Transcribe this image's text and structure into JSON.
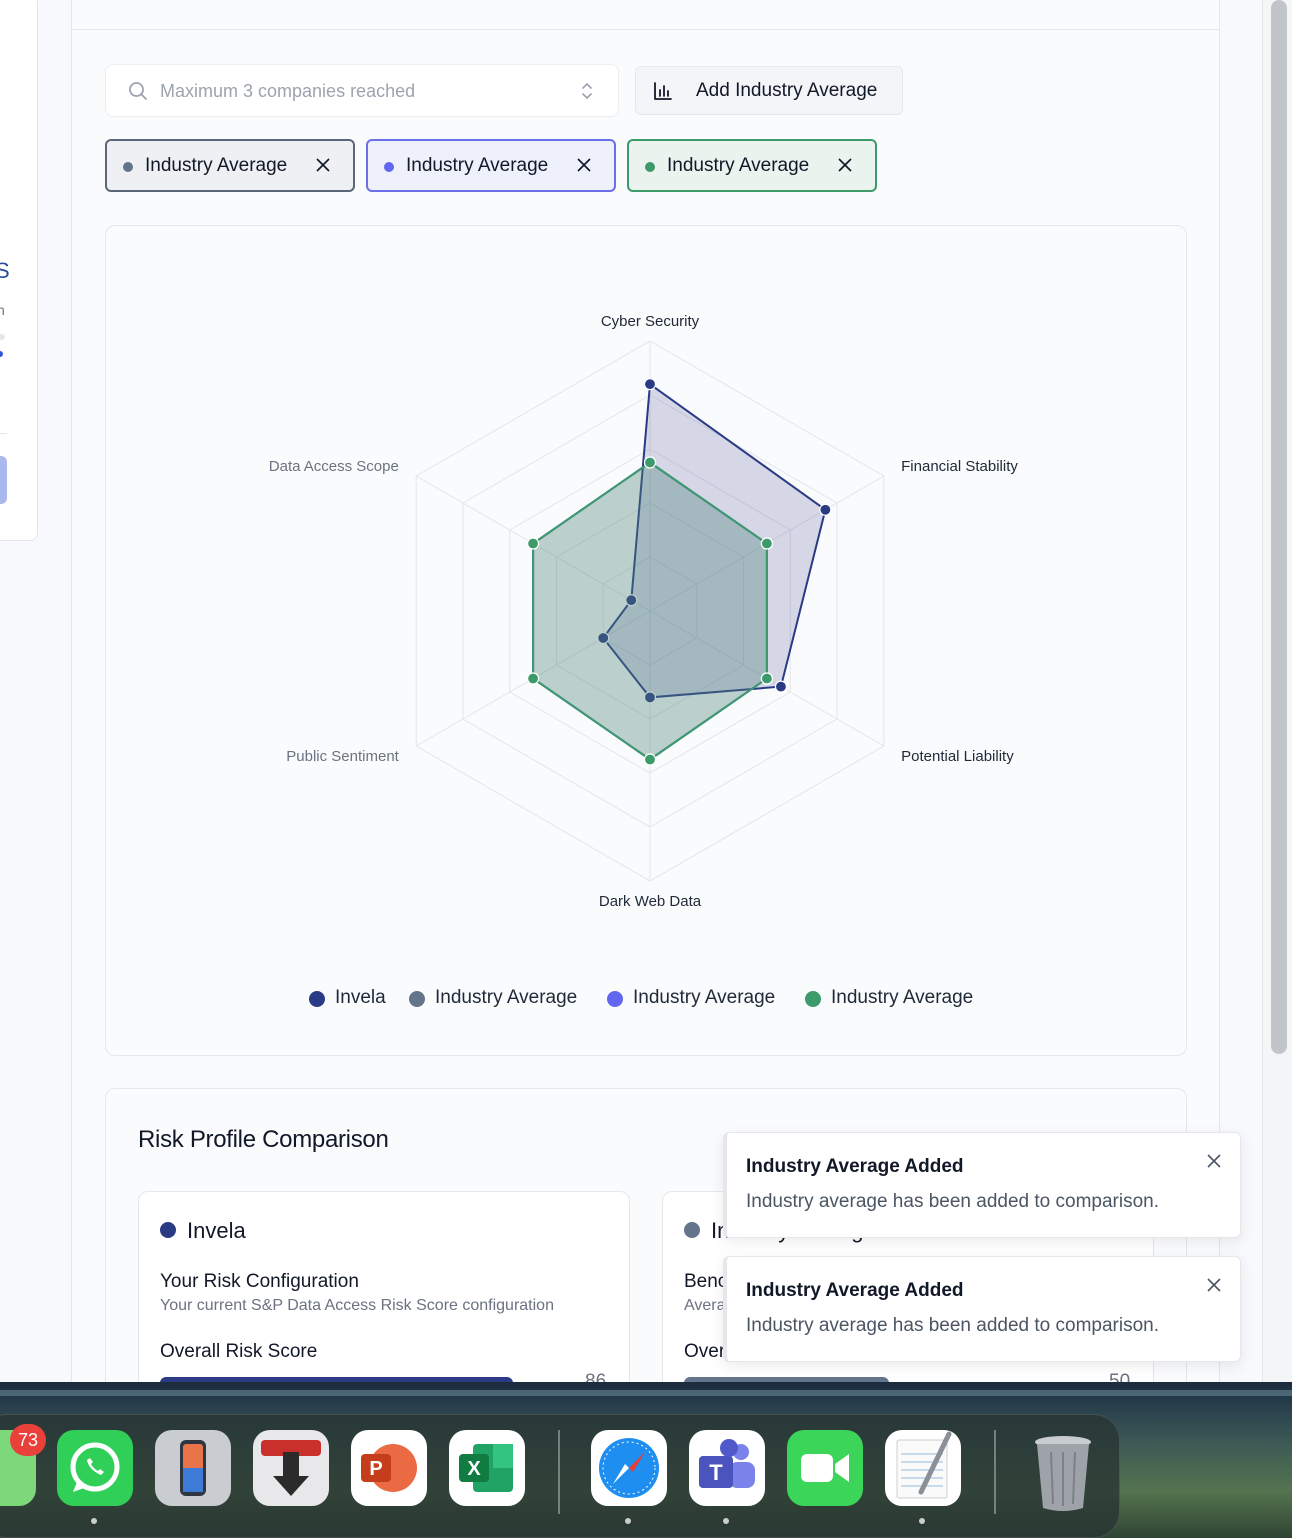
{
  "left_panel": {
    "fragment_s": "S",
    "fragment_n": "n"
  },
  "search": {
    "placeholder": "Maximum 3 companies reached"
  },
  "add_button": {
    "label": "Add Industry Average"
  },
  "chips": [
    {
      "label": "Industry Average",
      "color": "#64748b",
      "border": "#5b6678",
      "bg": "#eef0f4"
    },
    {
      "label": "Industry Average",
      "color": "#6366f1",
      "border": "#6b6ee8",
      "bg": "#eef0fb"
    },
    {
      "label": "Industry Average",
      "color": "#3d9a6b",
      "border": "#3d9a6b",
      "bg": "#eaf3ee"
    }
  ],
  "chart_data": {
    "type": "radar",
    "axes": [
      "Cyber Security",
      "Financial Stability",
      "Potential Liability",
      "Dark Web Data",
      "Public Sentiment",
      "Data Access Scope"
    ],
    "max": 100,
    "grid_levels": 5,
    "series": [
      {
        "name": "Invela",
        "color": "#2a3a85",
        "values": [
          84,
          75,
          56,
          32,
          20,
          8
        ]
      },
      {
        "name": "Industry Average",
        "color": "#64748b",
        "values": [
          55,
          50,
          50,
          55,
          50,
          50
        ]
      },
      {
        "name": "Industry Average",
        "color": "#6366f1",
        "values": [
          55,
          50,
          50,
          55,
          50,
          50
        ]
      },
      {
        "name": "Industry Average",
        "color": "#3d9a6b",
        "values": [
          55,
          50,
          50,
          55,
          50,
          50
        ]
      }
    ]
  },
  "risk": {
    "title": "Risk Profile Comparison",
    "cards": [
      {
        "name": "Invela",
        "color": "#2a3a85",
        "heading": "Your Risk Configuration",
        "subheading": "Your current S&P Data Access Risk Score configuration",
        "score_label": "Overall Risk Score",
        "score": "86",
        "fraction": 0.86
      },
      {
        "name": "Industry Average",
        "color": "#64748b",
        "heading": "Benchmark Configuration",
        "subheading": "Average industry risk configuration",
        "score_label": "Overall Risk Score",
        "score": "50",
        "fraction": 0.5
      }
    ]
  },
  "toasts": [
    {
      "title": "Industry Average Added",
      "body": "Industry average has been added to comparison."
    },
    {
      "title": "Industry Average Added",
      "body": "Industry average has been added to comparison."
    }
  ],
  "dock": {
    "badge": "73",
    "apps": [
      "messages-app",
      "whatsapp-app",
      "iphone-mirroring-app",
      "downloader-app",
      "powerpoint-app",
      "excel-app",
      "safari-app",
      "teams-app",
      "facetime-app",
      "textedit-app",
      "trash"
    ]
  }
}
